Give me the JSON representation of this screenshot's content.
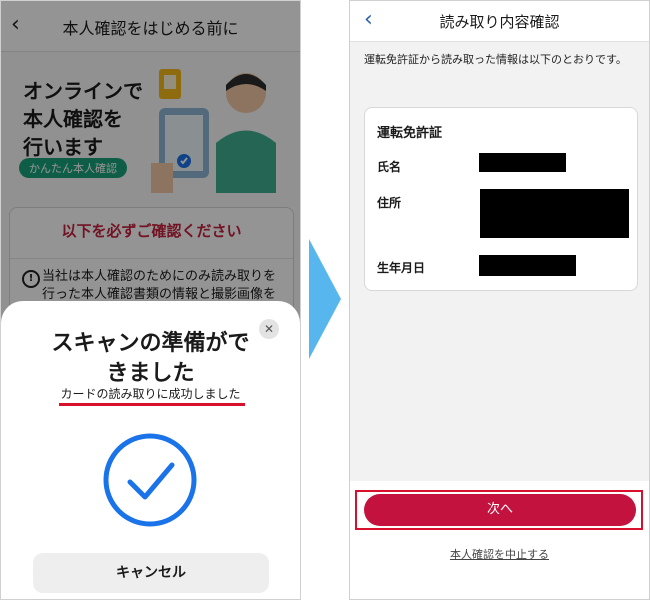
{
  "left": {
    "header_title": "本人確認をはじめる前に",
    "hero": {
      "line1": "オンラインで",
      "line2": "本人確認を",
      "line3": "行います",
      "tag": "かんたん本人確認"
    },
    "notice": {
      "title": "以下を必ずご確認ください",
      "text": "当社は本人確認のためにのみ読み取りを行った本人確認書類の情報と撮影画像を利用"
    },
    "sheet": {
      "title_line1": "スキャンの準備がで",
      "title_line2": "きました",
      "subtitle": "カードの読み取りに成功しました",
      "cancel_label": "キャンセル"
    }
  },
  "right": {
    "header_title": "読み取り内容確認",
    "intro": "運転免許証から読み取った情報は以下のとおりです。",
    "card": {
      "title": "運転免許証",
      "rows": [
        {
          "label": "氏名"
        },
        {
          "label": "住所"
        },
        {
          "label": "生年月日"
        }
      ]
    },
    "next_label": "次へ",
    "abort_label": "本人確認を中止する"
  },
  "colors": {
    "accent_red": "#c4123f",
    "highlight_red": "#d8102d",
    "check_blue": "#1a73e8",
    "arrow_blue": "#58b6ef",
    "tag_green": "#19a37a"
  },
  "icons": [
    "back-chevron-icon",
    "close-icon",
    "checkmark-circle-icon",
    "info-icon",
    "right-arrow-icon"
  ]
}
